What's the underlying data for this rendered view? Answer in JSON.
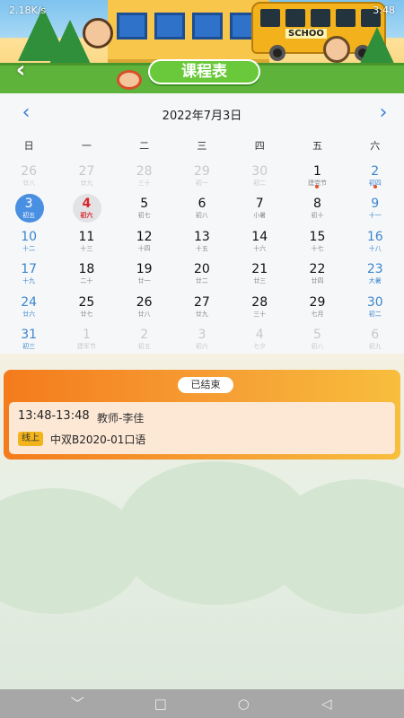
{
  "status_bar": {
    "network_speed": "2.18K/s",
    "time": "3:48"
  },
  "header": {
    "title": "课程表",
    "bus_sign": "SCHOO"
  },
  "icons": {
    "back": "chevron-left-icon",
    "prev": "chevron-left-icon",
    "next": "chevron-right-icon"
  },
  "colors": {
    "accent_blue": "#4a90e2",
    "title_green": "#69c93a",
    "card_orange": "#f47b1c",
    "tag_yellow": "#f2b41a"
  },
  "calendar": {
    "month_title": "2022年7月3日",
    "weekdays": [
      "日",
      "一",
      "二",
      "三",
      "四",
      "五",
      "六"
    ],
    "rows": [
      [
        {
          "n": "26",
          "s": "廿八",
          "m": true
        },
        {
          "n": "27",
          "s": "廿九",
          "m": true
        },
        {
          "n": "28",
          "s": "三十",
          "m": true
        },
        {
          "n": "29",
          "s": "初一",
          "m": true
        },
        {
          "n": "30",
          "s": "初二",
          "m": true
        },
        {
          "n": "1",
          "s": "建党节",
          "dot": true
        },
        {
          "n": "2",
          "s": "初四",
          "dot": true
        }
      ],
      [
        {
          "n": "3",
          "s": "初五",
          "sel": "today"
        },
        {
          "n": "4",
          "s": "初六",
          "sel": "event"
        },
        {
          "n": "5",
          "s": "初七"
        },
        {
          "n": "6",
          "s": "初八"
        },
        {
          "n": "7",
          "s": "小暑"
        },
        {
          "n": "8",
          "s": "初十"
        },
        {
          "n": "9",
          "s": "十一"
        }
      ],
      [
        {
          "n": "10",
          "s": "十二"
        },
        {
          "n": "11",
          "s": "十三"
        },
        {
          "n": "12",
          "s": "十四"
        },
        {
          "n": "13",
          "s": "十五"
        },
        {
          "n": "14",
          "s": "十六"
        },
        {
          "n": "15",
          "s": "十七"
        },
        {
          "n": "16",
          "s": "十八"
        }
      ],
      [
        {
          "n": "17",
          "s": "十九"
        },
        {
          "n": "18",
          "s": "二十"
        },
        {
          "n": "19",
          "s": "廿一"
        },
        {
          "n": "20",
          "s": "廿二"
        },
        {
          "n": "21",
          "s": "廿三"
        },
        {
          "n": "22",
          "s": "廿四"
        },
        {
          "n": "23",
          "s": "大暑"
        }
      ],
      [
        {
          "n": "24",
          "s": "廿六"
        },
        {
          "n": "25",
          "s": "廿七"
        },
        {
          "n": "26",
          "s": "廿八"
        },
        {
          "n": "27",
          "s": "廿九"
        },
        {
          "n": "28",
          "s": "三十"
        },
        {
          "n": "29",
          "s": "七月"
        },
        {
          "n": "30",
          "s": "初二"
        }
      ],
      [
        {
          "n": "31",
          "s": "初三"
        },
        {
          "n": "1",
          "s": "建军节",
          "m": true
        },
        {
          "n": "2",
          "s": "初五",
          "m": true
        },
        {
          "n": "3",
          "s": "初六",
          "m": true
        },
        {
          "n": "4",
          "s": "七夕",
          "m": true
        },
        {
          "n": "5",
          "s": "初八",
          "m": true
        },
        {
          "n": "6",
          "s": "初九",
          "m": true
        }
      ]
    ]
  },
  "course": {
    "status": "已结束",
    "time": "13:48-13:48",
    "teacher": "教师-李佳",
    "tag": "线上",
    "name": "中双B2020-01口语"
  },
  "navbar": {
    "back": "◁",
    "home": "○",
    "recents": "□",
    "hide": "﹀"
  }
}
